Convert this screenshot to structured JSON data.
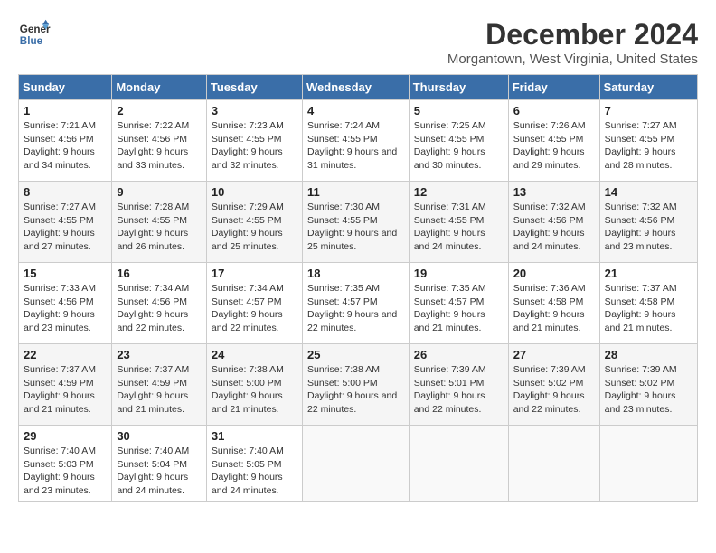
{
  "header": {
    "logo_line1": "General",
    "logo_line2": "Blue",
    "month_year": "December 2024",
    "location": "Morgantown, West Virginia, United States"
  },
  "days_of_week": [
    "Sunday",
    "Monday",
    "Tuesday",
    "Wednesday",
    "Thursday",
    "Friday",
    "Saturday"
  ],
  "weeks": [
    [
      {
        "day": "1",
        "sunrise": "7:21 AM",
        "sunset": "4:56 PM",
        "daylight": "9 hours and 34 minutes"
      },
      {
        "day": "2",
        "sunrise": "7:22 AM",
        "sunset": "4:56 PM",
        "daylight": "9 hours and 33 minutes"
      },
      {
        "day": "3",
        "sunrise": "7:23 AM",
        "sunset": "4:55 PM",
        "daylight": "9 hours and 32 minutes"
      },
      {
        "day": "4",
        "sunrise": "7:24 AM",
        "sunset": "4:55 PM",
        "daylight": "9 hours and 31 minutes"
      },
      {
        "day": "5",
        "sunrise": "7:25 AM",
        "sunset": "4:55 PM",
        "daylight": "9 hours and 30 minutes"
      },
      {
        "day": "6",
        "sunrise": "7:26 AM",
        "sunset": "4:55 PM",
        "daylight": "9 hours and 29 minutes"
      },
      {
        "day": "7",
        "sunrise": "7:27 AM",
        "sunset": "4:55 PM",
        "daylight": "9 hours and 28 minutes"
      }
    ],
    [
      {
        "day": "8",
        "sunrise": "7:27 AM",
        "sunset": "4:55 PM",
        "daylight": "9 hours and 27 minutes"
      },
      {
        "day": "9",
        "sunrise": "7:28 AM",
        "sunset": "4:55 PM",
        "daylight": "9 hours and 26 minutes"
      },
      {
        "day": "10",
        "sunrise": "7:29 AM",
        "sunset": "4:55 PM",
        "daylight": "9 hours and 25 minutes"
      },
      {
        "day": "11",
        "sunrise": "7:30 AM",
        "sunset": "4:55 PM",
        "daylight": "9 hours and 25 minutes"
      },
      {
        "day": "12",
        "sunrise": "7:31 AM",
        "sunset": "4:55 PM",
        "daylight": "9 hours and 24 minutes"
      },
      {
        "day": "13",
        "sunrise": "7:32 AM",
        "sunset": "4:56 PM",
        "daylight": "9 hours and 24 minutes"
      },
      {
        "day": "14",
        "sunrise": "7:32 AM",
        "sunset": "4:56 PM",
        "daylight": "9 hours and 23 minutes"
      }
    ],
    [
      {
        "day": "15",
        "sunrise": "7:33 AM",
        "sunset": "4:56 PM",
        "daylight": "9 hours and 23 minutes"
      },
      {
        "day": "16",
        "sunrise": "7:34 AM",
        "sunset": "4:56 PM",
        "daylight": "9 hours and 22 minutes"
      },
      {
        "day": "17",
        "sunrise": "7:34 AM",
        "sunset": "4:57 PM",
        "daylight": "9 hours and 22 minutes"
      },
      {
        "day": "18",
        "sunrise": "7:35 AM",
        "sunset": "4:57 PM",
        "daylight": "9 hours and 22 minutes"
      },
      {
        "day": "19",
        "sunrise": "7:35 AM",
        "sunset": "4:57 PM",
        "daylight": "9 hours and 21 minutes"
      },
      {
        "day": "20",
        "sunrise": "7:36 AM",
        "sunset": "4:58 PM",
        "daylight": "9 hours and 21 minutes"
      },
      {
        "day": "21",
        "sunrise": "7:37 AM",
        "sunset": "4:58 PM",
        "daylight": "9 hours and 21 minutes"
      }
    ],
    [
      {
        "day": "22",
        "sunrise": "7:37 AM",
        "sunset": "4:59 PM",
        "daylight": "9 hours and 21 minutes"
      },
      {
        "day": "23",
        "sunrise": "7:37 AM",
        "sunset": "4:59 PM",
        "daylight": "9 hours and 21 minutes"
      },
      {
        "day": "24",
        "sunrise": "7:38 AM",
        "sunset": "5:00 PM",
        "daylight": "9 hours and 21 minutes"
      },
      {
        "day": "25",
        "sunrise": "7:38 AM",
        "sunset": "5:00 PM",
        "daylight": "9 hours and 22 minutes"
      },
      {
        "day": "26",
        "sunrise": "7:39 AM",
        "sunset": "5:01 PM",
        "daylight": "9 hours and 22 minutes"
      },
      {
        "day": "27",
        "sunrise": "7:39 AM",
        "sunset": "5:02 PM",
        "daylight": "9 hours and 22 minutes"
      },
      {
        "day": "28",
        "sunrise": "7:39 AM",
        "sunset": "5:02 PM",
        "daylight": "9 hours and 23 minutes"
      }
    ],
    [
      {
        "day": "29",
        "sunrise": "7:40 AM",
        "sunset": "5:03 PM",
        "daylight": "9 hours and 23 minutes"
      },
      {
        "day": "30",
        "sunrise": "7:40 AM",
        "sunset": "5:04 PM",
        "daylight": "9 hours and 24 minutes"
      },
      {
        "day": "31",
        "sunrise": "7:40 AM",
        "sunset": "5:05 PM",
        "daylight": "9 hours and 24 minutes"
      },
      null,
      null,
      null,
      null
    ]
  ]
}
